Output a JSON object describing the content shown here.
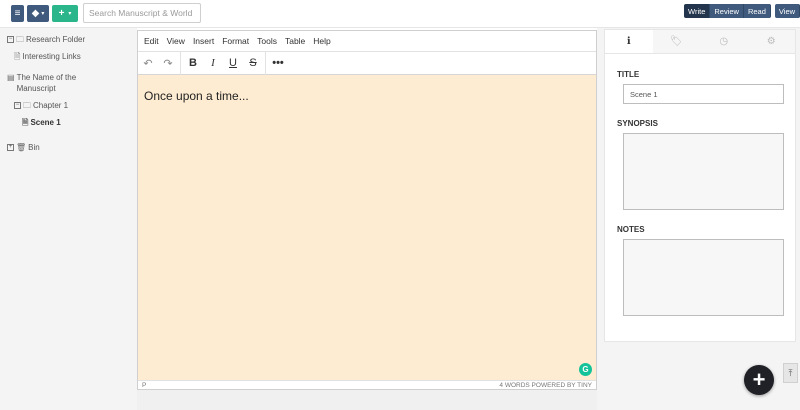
{
  "topbar": {
    "search_placeholder": "Search Manuscript & World",
    "icons": {
      "menu": "hamburger-icon",
      "layers": "layers-icon",
      "add": "plus-icon"
    },
    "modes": [
      "Write",
      "Review",
      "Read"
    ],
    "view_label": "View",
    "active_mode": "Write",
    "colors": {
      "primary": "#3f5a7d",
      "active": "#23354d",
      "add": "#2bb58a"
    }
  },
  "sidebar": {
    "items": [
      {
        "label": "Research Folder",
        "type": "folder",
        "toggle": "−"
      },
      {
        "label": "Interesting Links",
        "type": "doc"
      },
      {
        "label": "The Name of the Manuscript",
        "type": "book"
      },
      {
        "label": "Chapter 1",
        "type": "folder",
        "toggle": "−"
      },
      {
        "label": "Scene 1",
        "type": "doc",
        "selected": true
      },
      {
        "label": "Bin",
        "type": "trash",
        "toggle": "+"
      }
    ]
  },
  "editor": {
    "menu": [
      "Edit",
      "View",
      "Insert",
      "Format",
      "Tools",
      "Table",
      "Help"
    ],
    "toolbar": [
      "undo-icon",
      "redo-icon",
      "bold-icon",
      "italic-icon",
      "underline-icon",
      "strikethrough-icon",
      "more-icon"
    ],
    "content": "Once upon a time...",
    "status_path": "P",
    "status_right": "4 WORDS  POWERED BY TINY",
    "background": "#feecd2"
  },
  "panel": {
    "tabs": [
      "info-icon",
      "tag-icon",
      "clock-icon",
      "gear-icon"
    ],
    "title_label": "TITLE",
    "title_value": "Scene 1",
    "synopsis_label": "SYNOPSIS",
    "notes_label": "NOTES"
  }
}
